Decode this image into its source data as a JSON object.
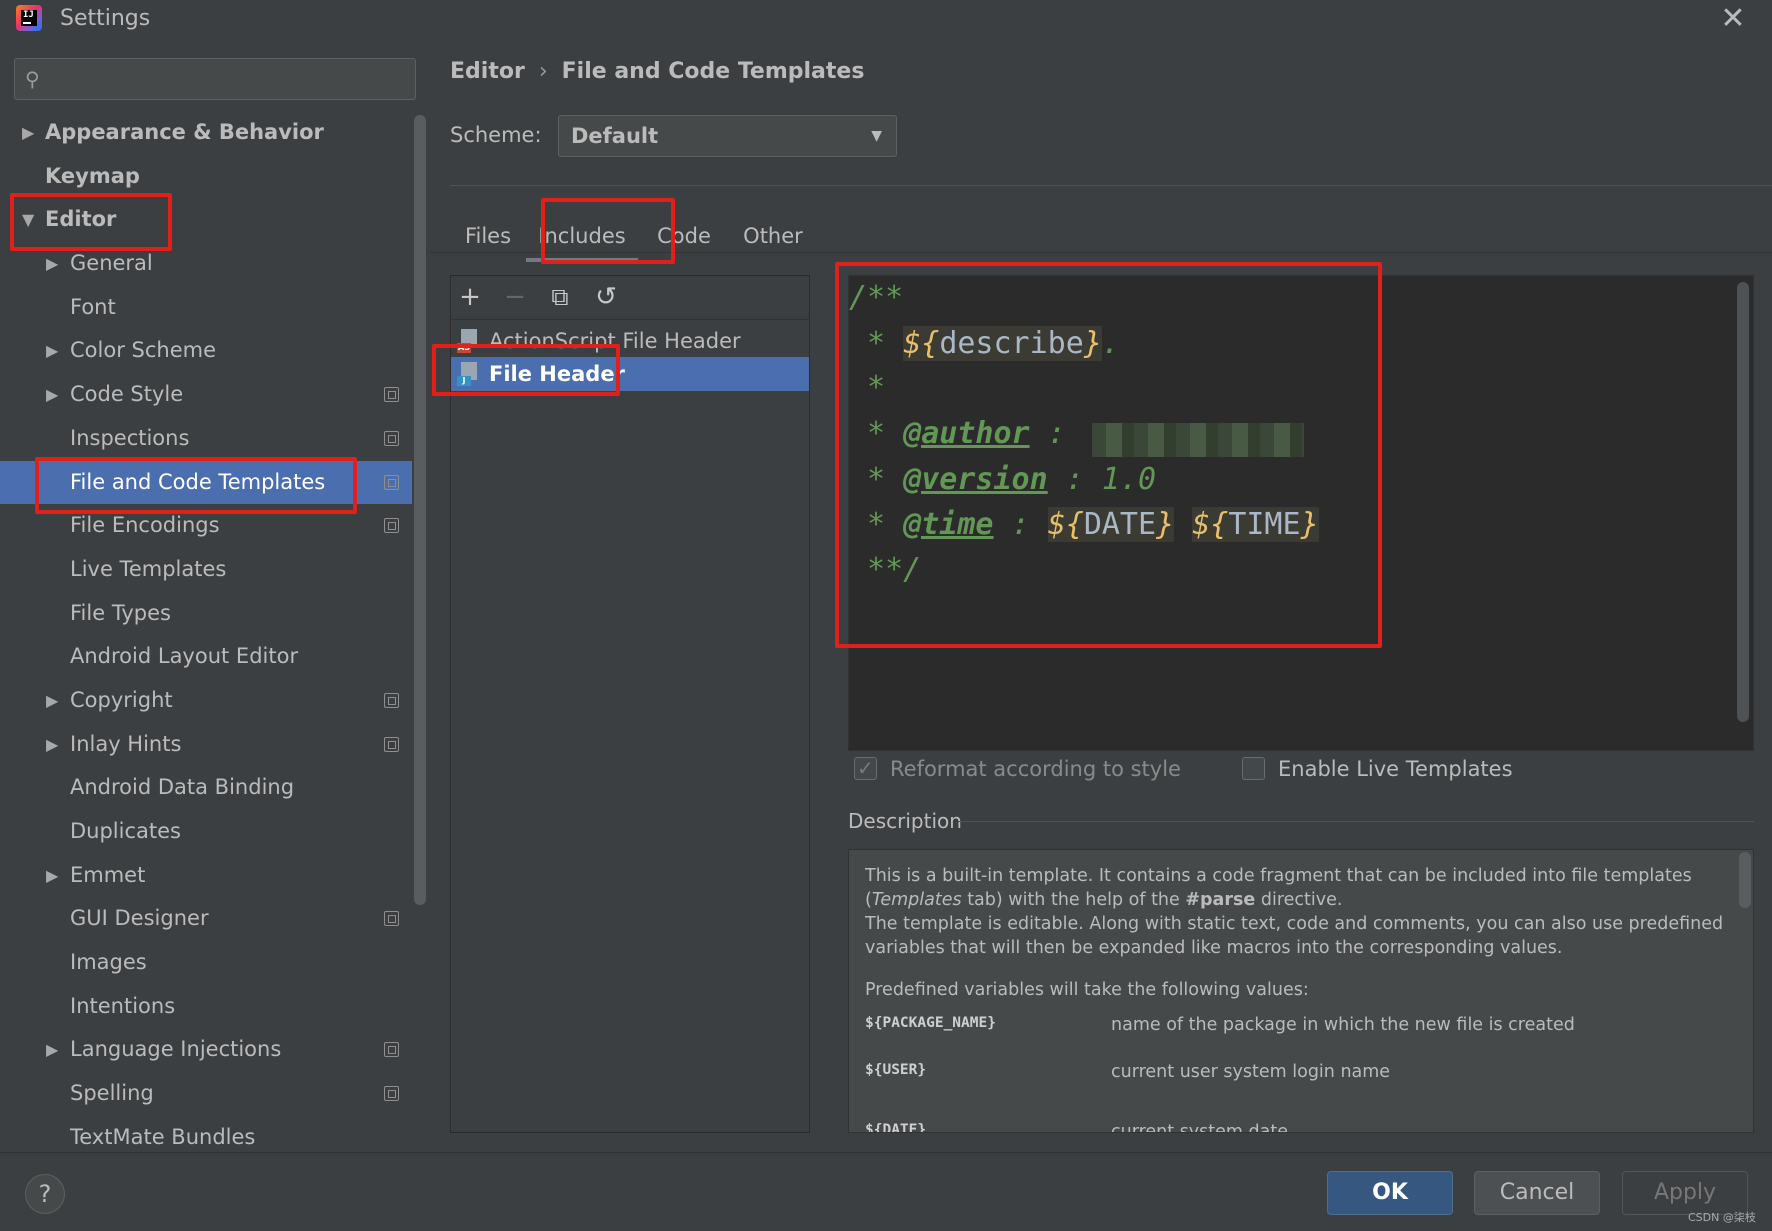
{
  "window": {
    "title": "Settings"
  },
  "search": {
    "placeholder": ""
  },
  "sidebar": {
    "items": [
      {
        "label": "Appearance & Behavior",
        "expand": "▶"
      },
      {
        "label": "Keymap"
      },
      {
        "label": "Editor",
        "expand": "▼"
      },
      {
        "label": "General",
        "expand": "▶"
      },
      {
        "label": "Font"
      },
      {
        "label": "Color Scheme",
        "expand": "▶"
      },
      {
        "label": "Code Style",
        "expand": "▶"
      },
      {
        "label": "Inspections"
      },
      {
        "label": "File and Code Templates"
      },
      {
        "label": "File Encodings"
      },
      {
        "label": "Live Templates"
      },
      {
        "label": "File Types"
      },
      {
        "label": "Android Layout Editor"
      },
      {
        "label": "Copyright",
        "expand": "▶"
      },
      {
        "label": "Inlay Hints",
        "expand": "▶"
      },
      {
        "label": "Android Data Binding"
      },
      {
        "label": "Duplicates"
      },
      {
        "label": "Emmet",
        "expand": "▶"
      },
      {
        "label": "GUI Designer"
      },
      {
        "label": "Images"
      },
      {
        "label": "Intentions"
      },
      {
        "label": "Language Injections",
        "expand": "▶"
      },
      {
        "label": "Spelling"
      },
      {
        "label": "TextMate Bundles"
      }
    ]
  },
  "breadcrumb": {
    "parent": "Editor",
    "sep": "›",
    "current": "File and Code Templates"
  },
  "scheme": {
    "label": "Scheme:",
    "value": "Default",
    "caret": "▼"
  },
  "tabs": {
    "files": "Files",
    "includes": "Includes",
    "code": "Code",
    "other": "Other"
  },
  "toolbar": {
    "add": "+",
    "remove": "−",
    "copy": "⧉",
    "reset": "↺"
  },
  "templates": {
    "items": [
      {
        "name": "ActionScript File Header",
        "badge": "AS"
      },
      {
        "name": "File Header",
        "badge": "J"
      }
    ]
  },
  "code": {
    "l1": "/**",
    "star": " * ",
    "describe_open": "${",
    "describe_name": "describe",
    "describe_close": "}",
    "describe_dot": ".",
    "l3": " *",
    "author_tag": "@author",
    "author_colon": " : ",
    "version_tag": "@version",
    "version_rest": " : 1.0",
    "time_tag": "@time",
    "time_colon": " : ",
    "date_open": "${",
    "date_name": "DATE",
    "date_close": "}",
    "time_open": "${",
    "time_name": "TIME",
    "time_close": "}",
    "end": " **/"
  },
  "options": {
    "reformat": "Reformat according to style",
    "live_templates": "Enable Live Templates"
  },
  "description": {
    "title": "Description",
    "p1a": "This is a built-in template. It contains a code fragment that can be included into file templates",
    "p1b_open": "(",
    "p1b_italic": "Templates",
    "p1b_mid": " tab) with the help of the ",
    "p1b_bold": "#parse",
    "p1b_end": " directive.",
    "p2": "The template is editable. Along with static text, code and comments, you can also use predefined variables that will then be expanded like macros into the corresponding values.",
    "p3": "Predefined variables will take the following values:",
    "vars": [
      {
        "name": "${PACKAGE_NAME}",
        "desc": "name of the package in which the new file is created"
      },
      {
        "name": "${USER}",
        "desc": "current user system login name"
      },
      {
        "name": "${DATE}",
        "desc": "current system date"
      }
    ]
  },
  "footer": {
    "help": "?",
    "ok": "OK",
    "cancel": "Cancel",
    "apply": "Apply",
    "watermark": "CSDN @柒枝"
  }
}
